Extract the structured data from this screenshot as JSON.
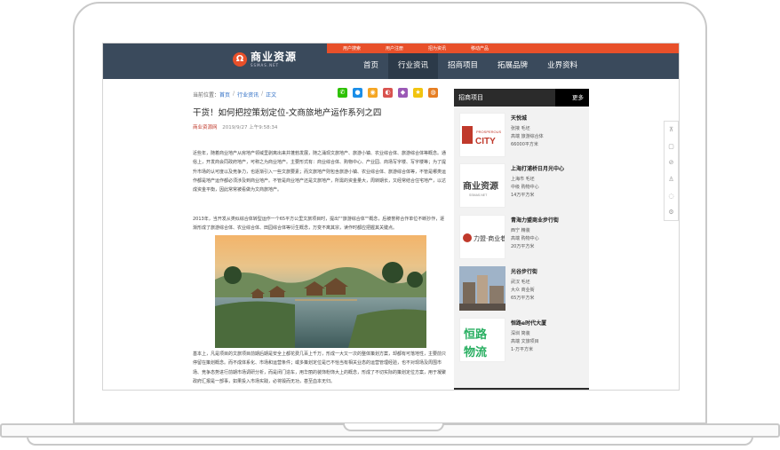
{
  "topbar": [
    "用户搜索",
    "用户注册",
    "招为资讯",
    "移动产品"
  ],
  "logo": {
    "cn": "商业资源",
    "en": "SSMAS.NET"
  },
  "nav": [
    "首页",
    "行业资讯",
    "招商项目",
    "拓展品牌",
    "业界资料"
  ],
  "breadcrumb": {
    "label": "当前位置：",
    "home": "首页",
    "section": "行业资讯",
    "current": "正文"
  },
  "article": {
    "title": "干货！如何把控策划定位-文商旅地产运作系列之四",
    "source": "商业资源网",
    "datetime": "2019/9/27 上午9:58:34",
    "p1": "近些年，随着商业地产从房地产领域里剥离出来并蓬勃发展，随之涌现文旅地产、旅游小镇、农业综合体、旅游综合体等概念。通俗上，开发商会同政府地产，可称之为商业地产。主要形式有：商业综合体、购物中心、产业园、商场写字楼、写字楼等；为了提升市场的认可度以及竞争力，也逐渐引入一些文旅要素；而文旅地产则包含旅游小镇、农业综合体、旅游综合体等，不管是哪类运作都是地产运作都必须涉及到商业地产。不管是商业地产还是文旅地产，所需的资金量大，周转期长，又经常结合住宅地产，以达成资金平衡，因此常常被看做为文商旅地产。",
    "p2": "2013年，当开发从类似综合体转型运作一个65平方公里文旅项目时，提出\"\"旅游综合体\"\"概念，后被誉称合作单位不断抄作，逐渐形成了旅游综合体、农业综合体、田园综合体等衍生概念，万变不离其宗，读作时都应把握其关键点。",
    "p3": "基本上，凡是项目的文旅项目前期后期是安全上都花费几百上千万，形成一大又一次的整体策划方案，却都有可落地性，主要前只停留在策划概念。而不成体系化、市场和运营条件；或多策划定位是已不恰当有相关业态的运营管理经验，也不对现场及周围市场、竞争态势进行前期市场调研分析，而是闭门造车，用华丽的装饰粉饰大上的概念，形成了不切实际的策划定位方案，用于凝聚政府汇报是一部事，如果投入市场实践，必将毁而无功，甚至血本无归。"
  },
  "sidebar": {
    "title": "招商项目",
    "more": "更多",
    "projects": [
      {
        "name": "天悦城",
        "l1": "张掖 毛坯",
        "l2": "高端 旅游综合体",
        "l3": "66000平方米",
        "img_text": "PROSPEROUS CITY"
      },
      {
        "name": "上海打浦桥日月光中心",
        "l1": "上海市 毛坯",
        "l2": "中级 购物中心",
        "l3": "14万平方米",
        "img_text": "商业资源"
      },
      {
        "name": "青海力盟商业步行街",
        "l1": "西宁 精装",
        "l2": "高端 购物中心",
        "l3": "20万平方米",
        "img_text": "力盟·商业巷"
      },
      {
        "name": "光谷步行街",
        "l1": "武汉 毛坯",
        "l2": "大众 商业街",
        "l3": "65万平方米",
        "img_text": ""
      },
      {
        "name": "恒路e时代大厦",
        "l1": "深圳 简装",
        "l2": "高端 文旅项目",
        "l3": "1-万平方米",
        "img_text": "恒路物流"
      }
    ]
  },
  "tools": [
    "回到顶部",
    "收藏",
    "禁止",
    "用户",
    "评论",
    "设置"
  ],
  "colors": {
    "header": "#3a4a5c",
    "accent": "#e8502a",
    "sidebar_head": "#2b2b2b"
  }
}
